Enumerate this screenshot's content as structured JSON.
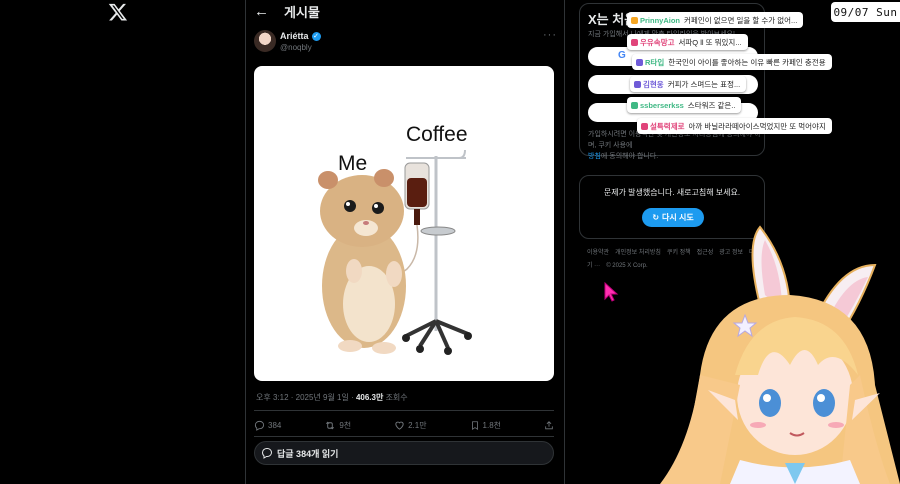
{
  "nav": {
    "logo": "x-logo"
  },
  "header": {
    "back_icon": "arrow-left-icon",
    "title": "게시물"
  },
  "post": {
    "author_name": "Ariétta",
    "author_handle": "@noqbly",
    "more_icon": "ellipsis-icon",
    "image_caption_me": "Me",
    "image_caption_coffee": "Coffee",
    "timestamp": "오후 3:12 · 2025년 9월 1일 · ",
    "views_count": "406.3만",
    "views_label": " 조회수",
    "actions": {
      "replies": "384",
      "reposts": "9천",
      "likes": "2.1만",
      "bookmarks": "1.8천"
    },
    "read_replies": "답글 384개 읽기"
  },
  "sidebar": {
    "signup_title": "X는 처음이세요?",
    "signup_sub": "지금 가입해서 나에게 맞춘 타임라인을 받아보세요!",
    "signup_terms_1": "가입하시려면 이용약관 및 개인정보 처리방침에 동의해야 하며, 쿠키 사용에",
    "signup_terms_link": "방침",
    "signup_terms_2": "에 동의해야 합니다.",
    "error_message": "문제가 발생했습니다. 새로고침해 보세요.",
    "retry_label": "다시 시도",
    "footer_links": [
      "이용약관",
      "개인정보 처리방침",
      "쿠키 정책",
      "접근성",
      "광고 정보",
      "더 보기 ···",
      "© 2025 X Corp."
    ]
  },
  "overlay": {
    "clock": "09/07 Sun",
    "chat": [
      {
        "user": "PrinnyAion",
        "user_color": "#3fb884",
        "msg": "커페인이 없으면 일을 할 수가 없어..."
      },
      {
        "user": "우유속망고",
        "user_color": "#e0447a",
        "msg": "서파Q ll 또 뭐있지..."
      },
      {
        "user": "R타입",
        "user_color": "#3fb884",
        "msg": "한국인이 아이를 좋아하는 이유 빠른 카페인 충전용"
      },
      {
        "user": "김현웅",
        "user_color": "#6f5bd8",
        "msg": "커피가 스며드는 표정..."
      },
      {
        "user": "ssberserkss",
        "user_color": "#3fb884",
        "msg": "스타워즈 같은.."
      },
      {
        "user": "설특력제로",
        "user_color": "#e0447a",
        "msg": "아까 바닐라라떼아이스먹었지만 또 먹어야지"
      }
    ]
  },
  "colors": {
    "accent": "#1d9bf0",
    "background": "#000000",
    "border": "#2f3336",
    "muted": "#71767b"
  }
}
